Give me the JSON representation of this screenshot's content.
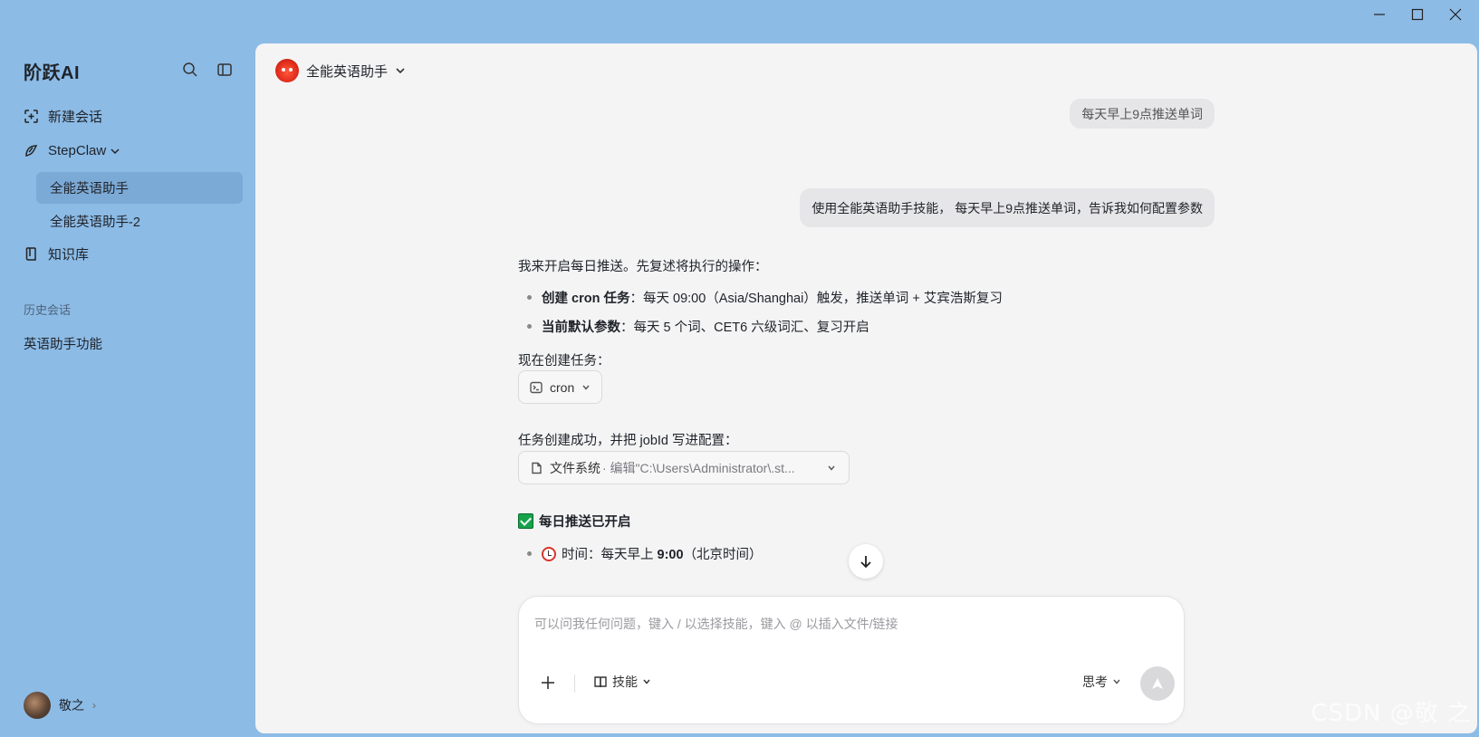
{
  "sidebar": {
    "brand": "阶跃AI",
    "new_chat": "新建会话",
    "stepclaw": "StepClaw",
    "sub_items": [
      "全能英语助手",
      "全能英语助手-2"
    ],
    "knowledge": "知识库",
    "history_label": "历史会话",
    "history_items": [
      "英语助手功能"
    ],
    "user_name": "敬之"
  },
  "header": {
    "assistant_name": "全能英语助手"
  },
  "messages": {
    "user_old": "每天早上9点推送单词",
    "user_main": "使用全能英语助手技能， 每天早上9点推送单词，告诉我如何配置参数"
  },
  "assistant": {
    "intro": "我来开启每日推送。先复述将执行的操作：",
    "bullet1_bold": "创建 cron 任务",
    "bullet1_rest": "：每天 09:00（Asia/Shanghai）触发，推送单词 + 艾宾浩斯复习",
    "bullet2_bold": "当前默认参数",
    "bullet2_rest": "：每天 5 个词、CET6 六级词汇、复习开启",
    "create_task": "现在创建任务：",
    "tool1_label": "cron",
    "task_created": "任务创建成功，并把 jobId 写进配置：",
    "tool2_label": "文件系统",
    "tool2_detail": "· 编辑\"C:\\Users\\Administrator\\.st...",
    "enabled_title": "每日推送已开启",
    "time_label": "时间：每天早上 ",
    "time_bold": "9:00",
    "time_rest": "（北京时间）"
  },
  "composer": {
    "placeholder": "可以问我任何问题，键入 / 以选择技能，键入 @ 以插入文件/链接",
    "skills_label": "技能",
    "think_label": "思考"
  },
  "watermark": "CSDN @敬 之"
}
